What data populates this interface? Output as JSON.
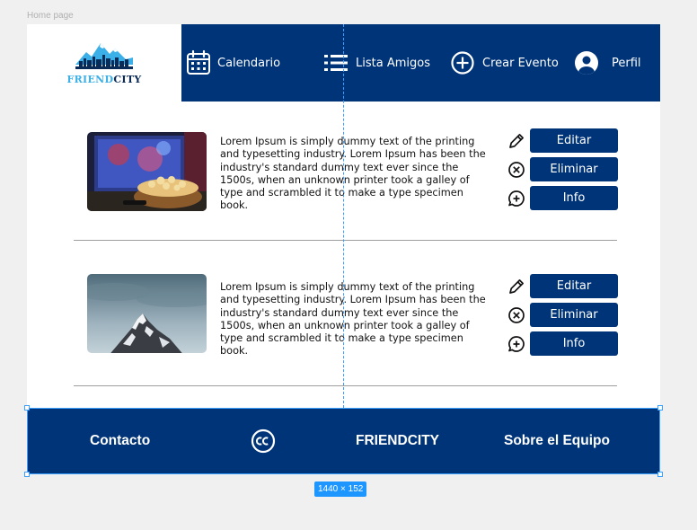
{
  "canvas": {
    "frame_label": "Home page",
    "size_badge": "1440 × 152"
  },
  "logo": {
    "text_part1": "FRIEND",
    "text_part2": "CITY",
    "colors": {
      "part1": "#3bb0e8",
      "part2": "#0a2a57"
    }
  },
  "nav": {
    "items": [
      {
        "label": "Calendario",
        "icon": "calendar-icon"
      },
      {
        "label": "Lista Amigos",
        "icon": "list-icon"
      },
      {
        "label": "Crear Evento",
        "icon": "plus-circle-icon"
      },
      {
        "label": "Perfil",
        "icon": "user-icon"
      }
    ]
  },
  "cards": [
    {
      "image": "popcorn-tv-image",
      "text": "Lorem Ipsum is simply dummy text of the printing and typesetting industry. Lorem Ipsum has been the industry's standard dummy text ever since the 1500s, when an unknown printer took a galley of type and scrambled it to make a type specimen book.",
      "actions": [
        {
          "label": "Editar",
          "icon": "pencil-icon"
        },
        {
          "label": "Eliminar",
          "icon": "x-circle-icon"
        },
        {
          "label": "Info",
          "icon": "chat-plus-icon"
        }
      ]
    },
    {
      "image": "mountain-image",
      "text": "Lorem Ipsum is simply dummy text of the printing and typesetting industry. Lorem Ipsum has been the industry's standard dummy text ever since the 1500s, when an unknown printer took a galley of type and scrambled it to make a type specimen book.",
      "actions": [
        {
          "label": "Editar",
          "icon": "pencil-icon"
        },
        {
          "label": "Eliminar",
          "icon": "x-circle-icon"
        },
        {
          "label": "Info",
          "icon": "chat-plus-icon"
        }
      ]
    }
  ],
  "footer": {
    "contact": "Contacto",
    "cc_icon": "creative-commons-icon",
    "brand": "FRIENDCITY",
    "team": "Sobre el Equipo"
  },
  "colors": {
    "primary": "#003478",
    "background": "#ffffff",
    "canvas": "#f0f0f0",
    "selection": "#3aa0ff"
  }
}
